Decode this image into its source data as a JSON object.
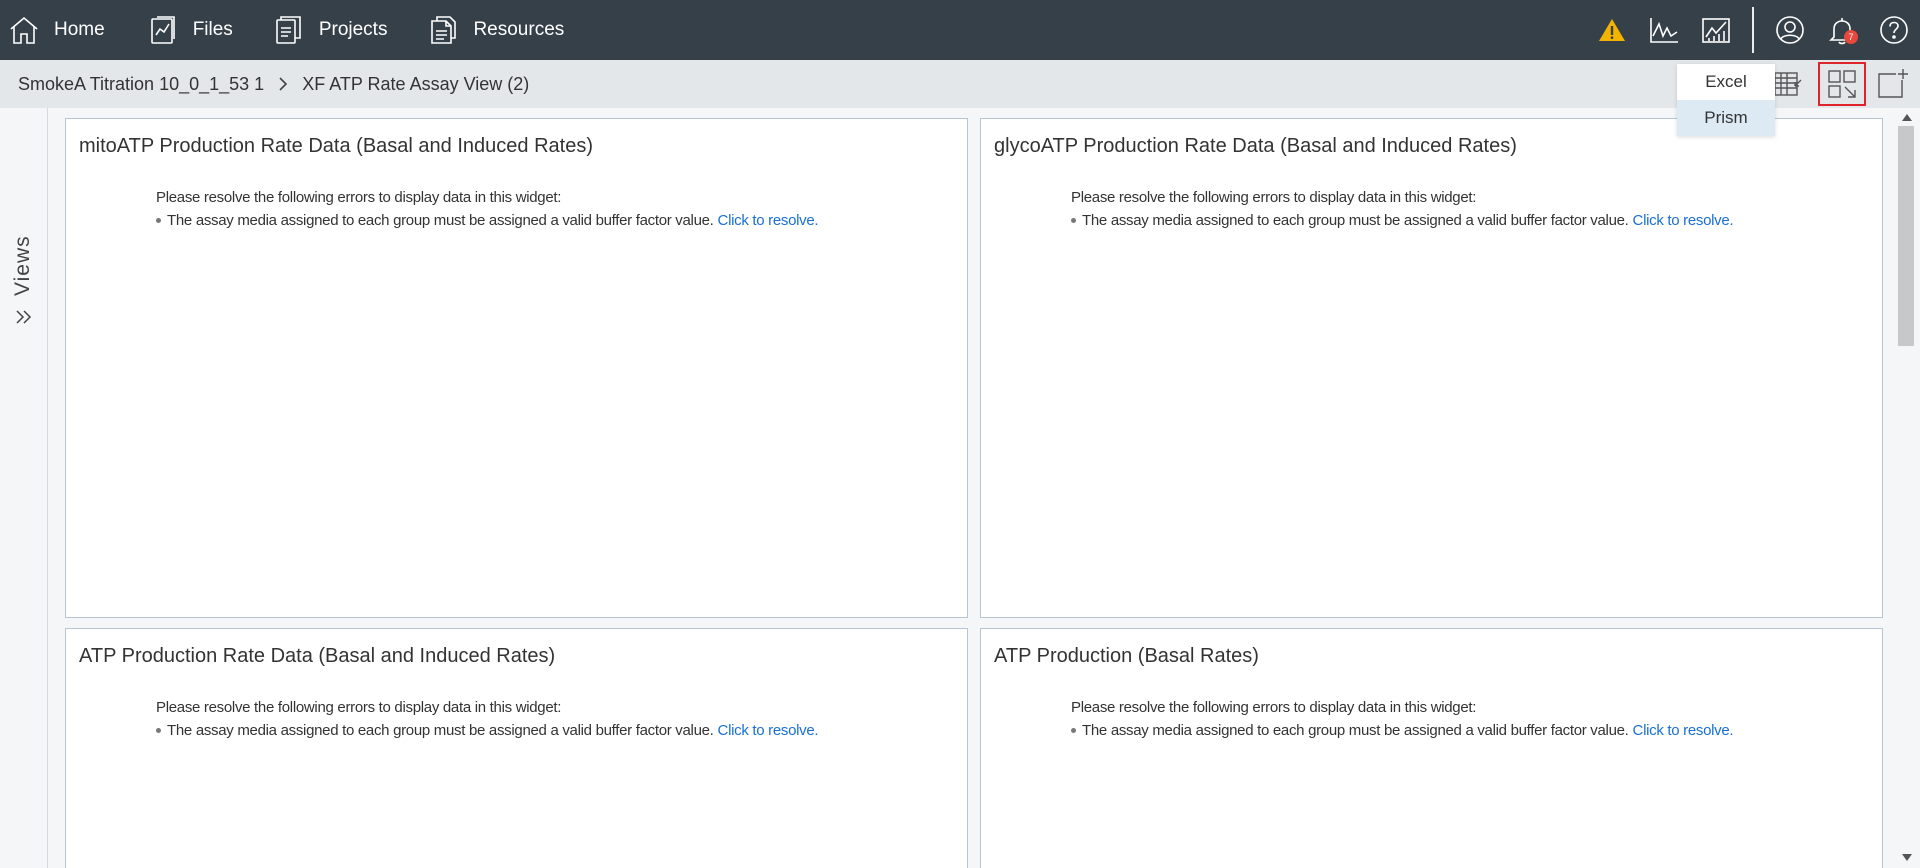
{
  "nav": {
    "home": "Home",
    "files": "Files",
    "projects": "Projects",
    "resources": "Resources",
    "notification_count": "7"
  },
  "breadcrumb": {
    "item1": "SmokeA Titration 10_0_1_53 1",
    "item2": "XF ATP Rate Assay View (2)"
  },
  "export_menu": {
    "excel": "Excel",
    "prism": "Prism"
  },
  "views_label": "Views",
  "widgets": [
    {
      "title": "mitoATP Production Rate Data (Basal and Induced Rates)",
      "error_head": "Please resolve the following errors to display data in this widget:",
      "error_item": "The assay media assigned to each group must be assigned a valid buffer factor value.",
      "resolve": "Click to resolve."
    },
    {
      "title": "glycoATP Production Rate Data (Basal and Induced Rates)",
      "error_head": "Please resolve the following errors to display data in this widget:",
      "error_item": "The assay media assigned to each group must be assigned a valid buffer factor value.",
      "resolve": "Click to resolve."
    },
    {
      "title": "ATP Production Rate Data (Basal and Induced Rates)",
      "error_head": "Please resolve the following errors to display data in this widget:",
      "error_item": "The assay media assigned to each group must be assigned a valid buffer factor value.",
      "resolve": "Click to resolve."
    },
    {
      "title": "ATP Production (Basal Rates)",
      "error_head": "Please resolve the following errors to display data in this widget:",
      "error_item": "The assay media assigned to each group must be assigned a valid buffer factor value.",
      "resolve": "Click to resolve."
    }
  ],
  "colors": {
    "topbar": "#364049",
    "warning": "#f3b300",
    "link": "#1a6fd4",
    "highlight_border": "#e0242b"
  }
}
